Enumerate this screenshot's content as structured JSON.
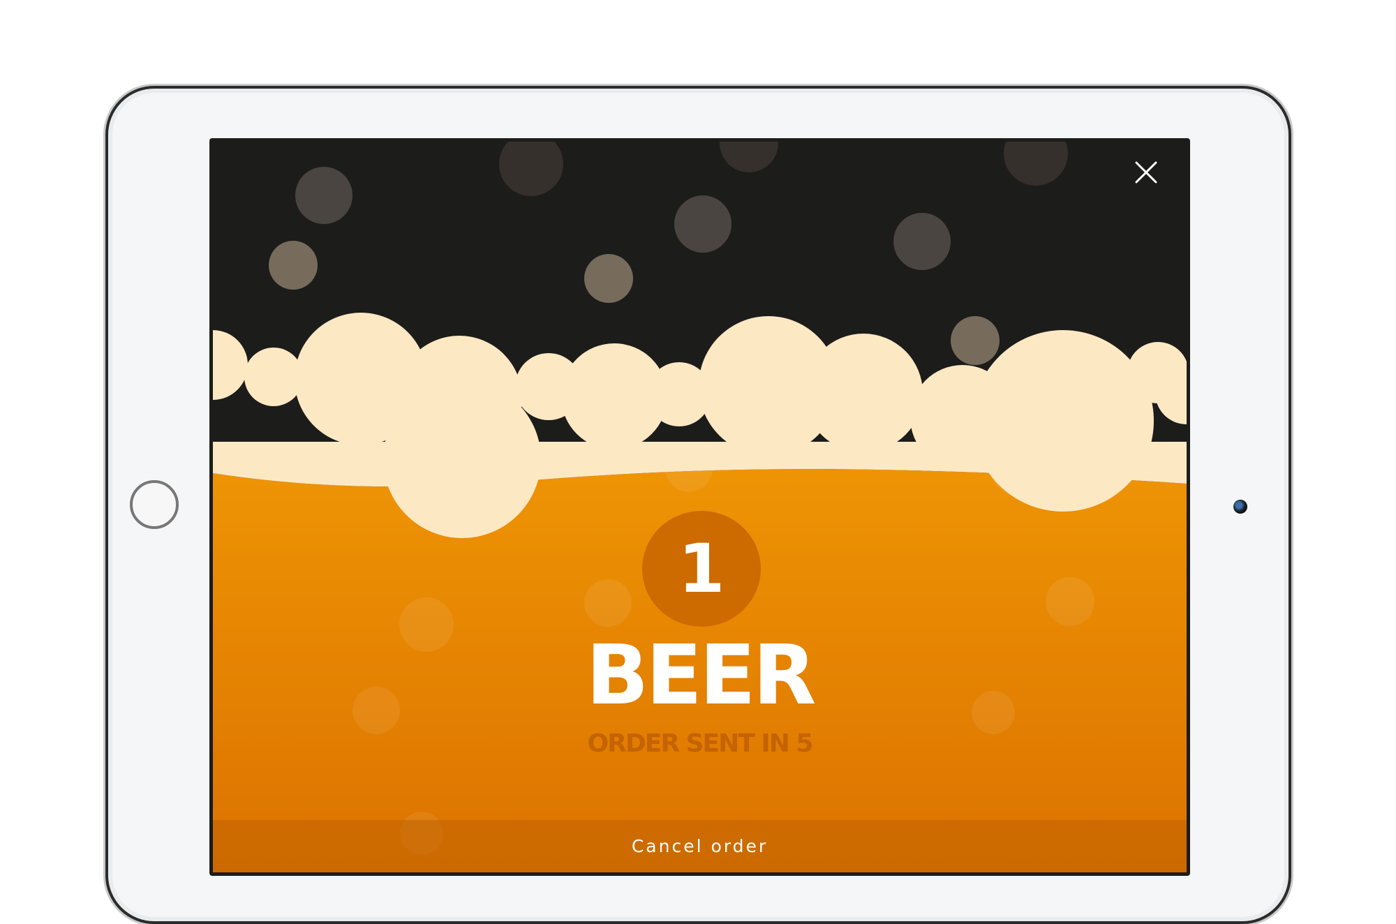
{
  "order": {
    "quantity": "1",
    "item": "BEER",
    "status": "ORDER SENT IN 5"
  },
  "actions": {
    "cancel_label": "Cancel order"
  },
  "icons": {
    "close": "close-icon"
  },
  "colors": {
    "background_dark": "#1c1c1a",
    "foam": "#fde8c4",
    "beer_top": "#ee9404",
    "beer_bottom": "#dc7200",
    "badge": "#cd6a00",
    "status_text": "#c46300"
  }
}
